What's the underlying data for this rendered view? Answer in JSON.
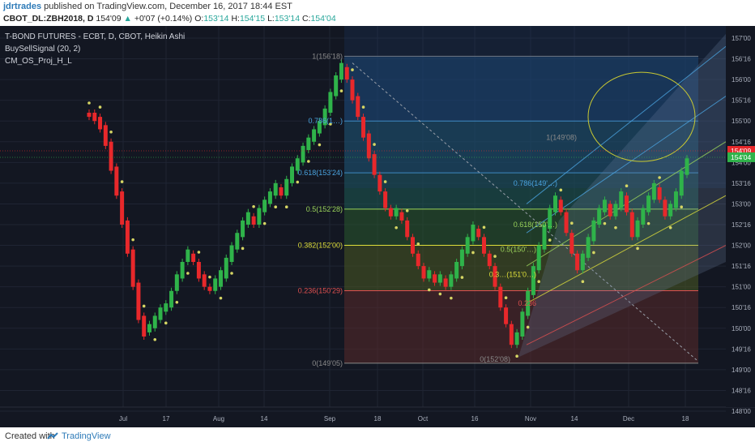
{
  "header": {
    "author": "jdrtrades",
    "published": "published on TradingView.com, December 16, 2017 18:44 EST",
    "symbol": "CBOT_DL:ZBH2018, D",
    "price": "154'09",
    "change": "+0'07 (+0.14%)",
    "ohlc": {
      "o_label": "O:",
      "o": "153'14",
      "h_label": "H:",
      "h": "154'15",
      "l_label": "L:",
      "l": "153'14",
      "c_label": "C:",
      "c": "154'04"
    }
  },
  "legend": {
    "title": "T-BOND FUTURES - ECBT, D, CBOT, Heikin Ashi",
    "indicator1": "BuySellSignal (20, 2)",
    "indicator2": "CM_OS_Proj_H_L"
  },
  "footer": {
    "created": "Created with",
    "brand": "TradingView"
  },
  "colors": {
    "bg": "#131722",
    "up": "#26a69a",
    "upbar": "#2fb34a",
    "down": "#e8282b",
    "dots": "#d6d664",
    "price_tag": "#e8282b",
    "close_tag": "#2fb34a"
  },
  "chart_data": {
    "type": "candlestick",
    "chart_style": "Heikin Ashi",
    "y_axis_ticks": [
      "157'00",
      "156'16",
      "156'00",
      "155'16",
      "155'00",
      "154'16",
      "154'00",
      "153'16",
      "153'00",
      "152'16",
      "152'00",
      "151'16",
      "151'00",
      "150'16",
      "150'00",
      "149'16",
      "149'00",
      "148'16",
      "148'00"
    ],
    "x_axis_ticks": [
      "Jul",
      "17",
      "Aug",
      "14",
      "Sep",
      "18",
      "Oct",
      "16",
      "Nov",
      "14",
      "Dec",
      "18"
    ],
    "price_tags": [
      {
        "label": "154'09",
        "value": 154.28,
        "role": "last"
      },
      {
        "label": "154'04",
        "value": 154.125,
        "role": "close"
      }
    ],
    "fib_retracement_1": {
      "from": 156.5625,
      "to": 149.15625,
      "levels": [
        {
          "ratio": "1",
          "label": "(156'18)",
          "value": 156.5625
        },
        {
          "ratio": "0.786",
          "label": "(1…)",
          "value": 155.0
        },
        {
          "ratio": "0.618",
          "label": "(153'24)",
          "value": 153.75
        },
        {
          "ratio": "0.5",
          "label": "(152'28)",
          "value": 152.875
        },
        {
          "ratio": "0.382",
          "label": "(152'00)",
          "value": 152.0
        },
        {
          "ratio": "0.236",
          "label": "(150'29)",
          "value": 150.906
        },
        {
          "ratio": "0",
          "label": "(149'05)",
          "value": 149.15625
        }
      ]
    },
    "fib_retracement_2": {
      "levels": [
        {
          "ratio": "1",
          "label": "(149'08)",
          "value": 154.6
        },
        {
          "ratio": "0.786",
          "label": "(149'…)",
          "value": 153.5
        },
        {
          "ratio": "0.618",
          "label": "(150'…)",
          "value": 152.5
        },
        {
          "ratio": "0.5",
          "label": "(150'…)",
          "value": 151.9
        },
        {
          "ratio": "0.3…",
          "label": "(151'0…)",
          "value": 151.3
        },
        {
          "ratio": "0.236",
          "label": "",
          "value": 150.6
        },
        {
          "ratio": "0",
          "label": "(152'08)",
          "value": 149.25
        }
      ]
    },
    "candles": [
      {
        "o": 155.2,
        "c": 155.1
      },
      {
        "o": 155.2,
        "c": 155.0
      },
      {
        "o": 155.1,
        "c": 154.8
      },
      {
        "o": 154.9,
        "c": 154.4
      },
      {
        "o": 154.5,
        "c": 153.8
      },
      {
        "o": 153.9,
        "c": 153.2
      },
      {
        "o": 153.3,
        "c": 152.5
      },
      {
        "o": 152.6,
        "c": 151.8
      },
      {
        "o": 151.9,
        "c": 151.0
      },
      {
        "o": 151.1,
        "c": 150.2
      },
      {
        "o": 150.3,
        "c": 149.8
      },
      {
        "o": 149.9,
        "c": 150.1
      },
      {
        "o": 150.0,
        "c": 150.3
      },
      {
        "o": 150.2,
        "c": 150.5
      },
      {
        "o": 150.4,
        "c": 150.6
      },
      {
        "o": 150.5,
        "c": 150.9
      },
      {
        "o": 150.9,
        "c": 151.3
      },
      {
        "o": 151.2,
        "c": 151.6
      },
      {
        "o": 151.6,
        "c": 151.9
      },
      {
        "o": 151.8,
        "c": 151.6
      },
      {
        "o": 151.6,
        "c": 151.2
      },
      {
        "o": 151.3,
        "c": 151.0
      },
      {
        "o": 151.0,
        "c": 150.9
      },
      {
        "o": 150.9,
        "c": 151.2
      },
      {
        "o": 151.0,
        "c": 151.4
      },
      {
        "o": 151.2,
        "c": 151.7
      },
      {
        "o": 151.6,
        "c": 152.0
      },
      {
        "o": 151.9,
        "c": 152.3
      },
      {
        "o": 152.2,
        "c": 152.6
      },
      {
        "o": 152.5,
        "c": 152.8
      },
      {
        "o": 152.7,
        "c": 152.5
      },
      {
        "o": 152.5,
        "c": 152.9
      },
      {
        "o": 152.8,
        "c": 153.1
      },
      {
        "o": 153.0,
        "c": 153.3
      },
      {
        "o": 153.2,
        "c": 153.5
      },
      {
        "o": 153.4,
        "c": 153.2
      },
      {
        "o": 153.2,
        "c": 153.6
      },
      {
        "o": 153.5,
        "c": 153.9
      },
      {
        "o": 153.8,
        "c": 154.1
      },
      {
        "o": 154.0,
        "c": 154.4
      },
      {
        "o": 154.3,
        "c": 154.6
      },
      {
        "o": 154.5,
        "c": 154.8
      },
      {
        "o": 154.7,
        "c": 155.0
      },
      {
        "o": 154.9,
        "c": 155.3
      },
      {
        "o": 155.2,
        "c": 155.7
      },
      {
        "o": 155.6,
        "c": 156.1
      },
      {
        "o": 156.0,
        "c": 156.4
      },
      {
        "o": 156.3,
        "c": 156.0
      },
      {
        "o": 156.0,
        "c": 155.5
      },
      {
        "o": 155.6,
        "c": 155.1
      },
      {
        "o": 155.1,
        "c": 154.6
      },
      {
        "o": 154.7,
        "c": 154.1
      },
      {
        "o": 154.2,
        "c": 153.7
      },
      {
        "o": 153.7,
        "c": 153.3
      },
      {
        "o": 153.3,
        "c": 152.9
      },
      {
        "o": 152.9,
        "c": 152.7
      },
      {
        "o": 152.7,
        "c": 152.9
      },
      {
        "o": 152.8,
        "c": 152.6
      },
      {
        "o": 152.6,
        "c": 152.2
      },
      {
        "o": 152.2,
        "c": 151.8
      },
      {
        "o": 151.8,
        "c": 151.5
      },
      {
        "o": 151.5,
        "c": 151.2
      },
      {
        "o": 151.2,
        "c": 151.4
      },
      {
        "o": 151.3,
        "c": 151.1
      },
      {
        "o": 151.1,
        "c": 151.3
      },
      {
        "o": 151.2,
        "c": 151.0
      },
      {
        "o": 151.0,
        "c": 151.3
      },
      {
        "o": 151.2,
        "c": 151.6
      },
      {
        "o": 151.5,
        "c": 151.9
      },
      {
        "o": 151.8,
        "c": 152.2
      },
      {
        "o": 152.1,
        "c": 152.5
      },
      {
        "o": 152.4,
        "c": 152.2
      },
      {
        "o": 152.2,
        "c": 151.8
      },
      {
        "o": 151.8,
        "c": 151.5
      },
      {
        "o": 151.5,
        "c": 151.0
      },
      {
        "o": 151.0,
        "c": 150.5
      },
      {
        "o": 150.5,
        "c": 150.1
      },
      {
        "o": 150.1,
        "c": 149.6
      },
      {
        "o": 149.6,
        "c": 149.9
      },
      {
        "o": 149.8,
        "c": 150.4
      },
      {
        "o": 150.3,
        "c": 150.9
      },
      {
        "o": 150.8,
        "c": 151.5
      },
      {
        "o": 151.4,
        "c": 152.0
      },
      {
        "o": 151.9,
        "c": 152.5
      },
      {
        "o": 152.4,
        "c": 152.9
      },
      {
        "o": 152.8,
        "c": 153.2
      },
      {
        "o": 153.1,
        "c": 152.8
      },
      {
        "o": 152.8,
        "c": 152.3
      },
      {
        "o": 152.3,
        "c": 151.8
      },
      {
        "o": 151.8,
        "c": 151.4
      },
      {
        "o": 151.4,
        "c": 151.8
      },
      {
        "o": 151.7,
        "c": 152.2
      },
      {
        "o": 152.1,
        "c": 152.6
      },
      {
        "o": 152.5,
        "c": 152.9
      },
      {
        "o": 152.8,
        "c": 153.1
      },
      {
        "o": 153.0,
        "c": 152.7
      },
      {
        "o": 152.7,
        "c": 153.0
      },
      {
        "o": 152.9,
        "c": 153.3
      },
      {
        "o": 153.2,
        "c": 152.8
      },
      {
        "o": 152.8,
        "c": 152.2
      },
      {
        "o": 152.2,
        "c": 152.6
      },
      {
        "o": 152.5,
        "c": 152.9
      },
      {
        "o": 152.8,
        "c": 153.2
      },
      {
        "o": 153.1,
        "c": 153.5
      },
      {
        "o": 153.4,
        "c": 153.1
      },
      {
        "o": 153.1,
        "c": 152.7
      },
      {
        "o": 152.7,
        "c": 153.0
      },
      {
        "o": 152.9,
        "c": 153.3
      },
      {
        "o": 153.2,
        "c": 153.8
      },
      {
        "o": 153.7,
        "c": 154.1
      }
    ]
  }
}
